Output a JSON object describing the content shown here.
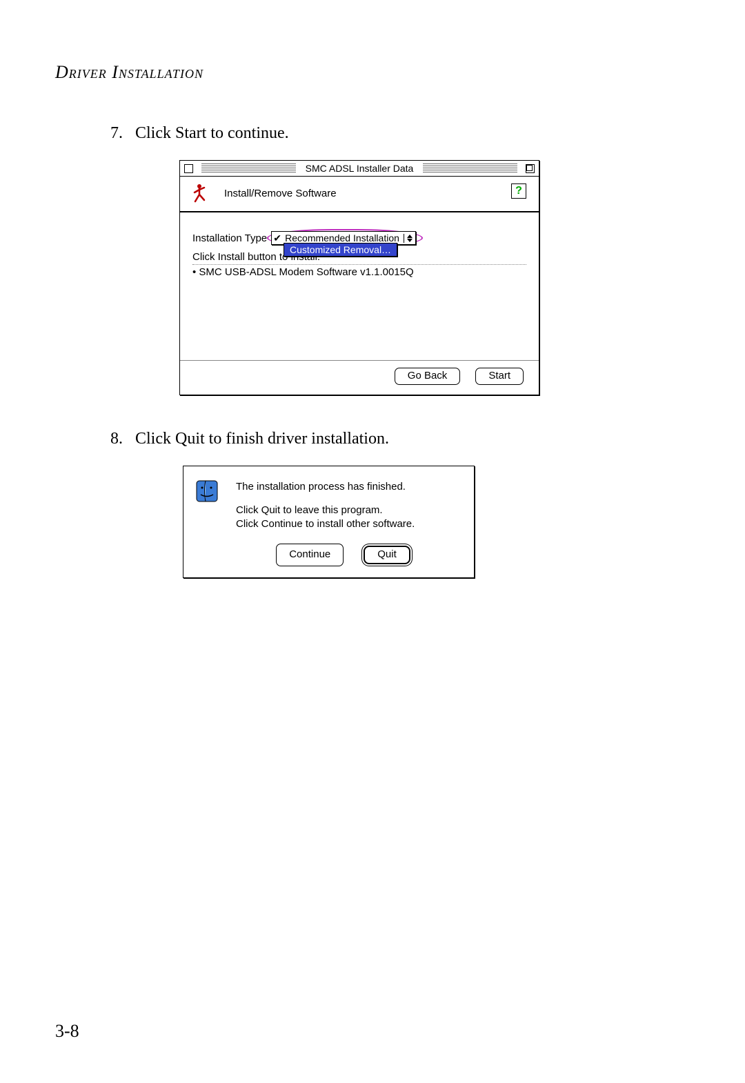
{
  "section_title": "Driver Installation",
  "steps": {
    "s7": {
      "num": "7.",
      "text": "Click Start to continue."
    },
    "s8": {
      "num": "8.",
      "text": "Click Quit to finish driver installation."
    }
  },
  "dialog1": {
    "title": "SMC ADSL Installer Data",
    "header_label": "Install/Remove Software",
    "help_symbol": "?",
    "install_type_label": "Installation Type",
    "dropdown_check": "✔",
    "dropdown_selected": "Recommended Installation",
    "dropdown_open_item": "Customized Removal…",
    "line_click_install": "Click Install button to install:",
    "bullet_item": "SMC USB-ADSL Modem Software v1.1.0015Q",
    "go_back": "Go Back",
    "start": "Start"
  },
  "dialog2": {
    "line1": "The installation process has finished.",
    "line2": "Click Quit to leave this program.",
    "line3": "Click Continue to install other software.",
    "continue": "Continue",
    "quit": "Quit"
  },
  "page_number": "3-8"
}
